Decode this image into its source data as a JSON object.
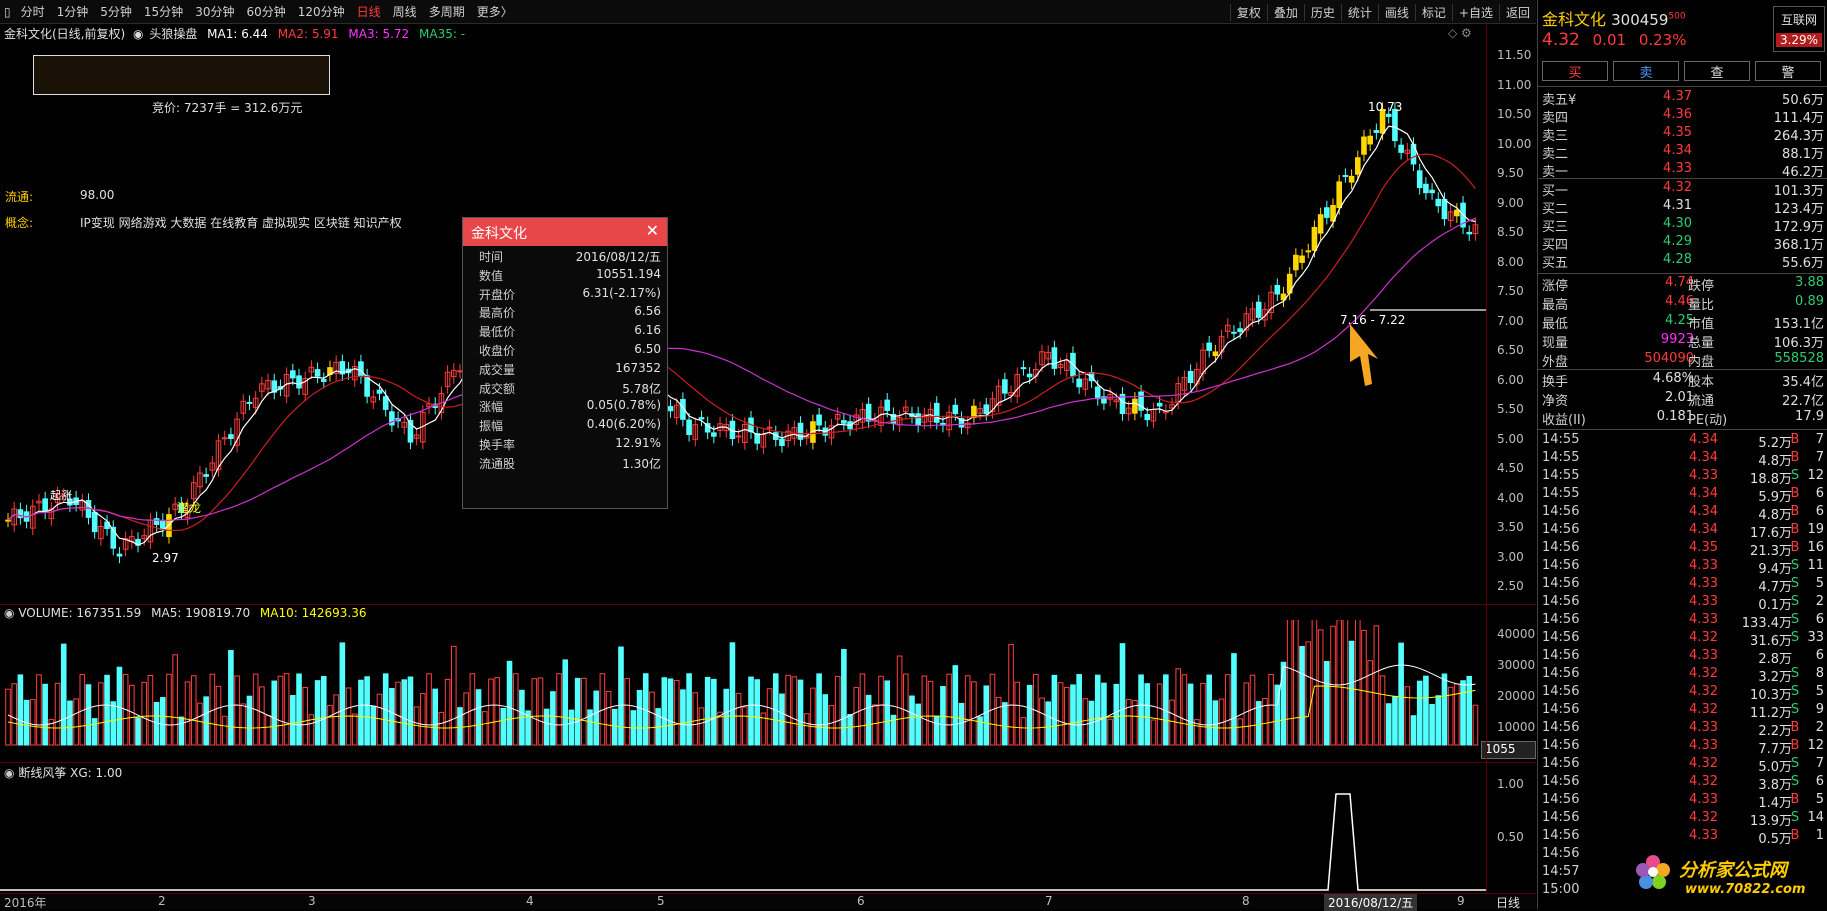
{
  "toolbar": {
    "tabs": [
      "分时",
      "1分钟",
      "5分钟",
      "15分钟",
      "30分钟",
      "60分钟",
      "120分钟",
      "日线",
      "周线",
      "多周期",
      "更多〉"
    ],
    "active_tab": "日线",
    "right_buttons": [
      "复权",
      "叠加",
      "历史",
      "统计",
      "画线",
      "标记",
      "+自选",
      "返回"
    ]
  },
  "chart": {
    "title": "金科文化(日线,前复权)",
    "indicator": "头狼操盘",
    "ma1": "MA1: 6.44",
    "ma2": "MA2: 5.91",
    "ma3": "MA3: 5.72",
    "ma35": "MA35: -",
    "auction": "竞价: 7237手 = 312.6万元",
    "liutong_label": "流通:",
    "liutong_value": "98.00",
    "concept_label": "概念:",
    "concept_value": "IP变现 网络游戏 大数据 在线教育 虚拟现实 区块链 知识产权",
    "high_label": "10.73",
    "low_label": "2.97",
    "range_label": "7.16 - 7.22",
    "qian_long": "潜龙",
    "qi_zhang": "起涨",
    "y_ticks": [
      "11.50",
      "11.00",
      "10.50",
      "10.00",
      "9.50",
      "9.00",
      "8.50",
      "8.00",
      "7.50",
      "7.00",
      "6.50",
      "6.00",
      "5.50",
      "5.00",
      "4.50",
      "4.00",
      "3.50",
      "3.00",
      "2.50"
    ]
  },
  "volume": {
    "label": "VOLUME: 167351.59",
    "ma5": "MA5: 190819.70",
    "ma10": "MA10: 142693.36",
    "y_ticks": [
      "40000",
      "30000",
      "20000",
      "10000"
    ],
    "current": "1055"
  },
  "indicator2": {
    "label": "断线风筝 XG: 1.00",
    "y_ticks": [
      "1.00",
      "0.50"
    ]
  },
  "x_axis": {
    "labels": [
      "2016年",
      "2",
      "3",
      "4",
      "5",
      "6",
      "7",
      "8",
      "9"
    ],
    "current_date": "2016/08/12/五",
    "period": "日线"
  },
  "popup": {
    "title": "金科文化",
    "rows": [
      {
        "k": "时间",
        "v": "2016/08/12/五",
        "c": "white"
      },
      {
        "k": "数值",
        "v": "10551.194",
        "c": "white"
      },
      {
        "k": "开盘价",
        "v": "6.31(-2.17%)",
        "c": "green"
      },
      {
        "k": "最高价",
        "v": "6.56",
        "c": "red"
      },
      {
        "k": "最低价",
        "v": "6.16",
        "c": "green"
      },
      {
        "k": "收盘价",
        "v": "6.50",
        "c": "red"
      },
      {
        "k": "成交量",
        "v": "167352",
        "c": "white"
      },
      {
        "k": "成交额",
        "v": "5.78亿",
        "c": "white"
      },
      {
        "k": "涨幅",
        "v": "0.05(0.78%)",
        "c": "red"
      },
      {
        "k": "振幅",
        "v": "0.40(6.20%)",
        "c": "white"
      },
      {
        "k": "换手率",
        "v": "12.91%",
        "c": "white"
      },
      {
        "k": "流通股",
        "v": "1.30亿",
        "c": "white"
      }
    ]
  },
  "stock": {
    "name": "金科文化",
    "code": "300459",
    "code_sup": "500",
    "price": "4.32",
    "change": "0.01",
    "change_pct": "0.23%",
    "tag": "互联网",
    "tag_pct": "3.29%",
    "buttons": [
      "买",
      "卖",
      "查",
      "警"
    ]
  },
  "orderbook": {
    "sell": [
      {
        "l": "卖五¥",
        "p": "4.37",
        "v": "50.6万",
        "c": "red"
      },
      {
        "l": "卖四",
        "p": "4.36",
        "v": "111.4万",
        "c": "red"
      },
      {
        "l": "卖三",
        "p": "4.35",
        "v": "264.3万",
        "c": "red"
      },
      {
        "l": "卖二",
        "p": "4.34",
        "v": "88.1万",
        "c": "red"
      },
      {
        "l": "卖一",
        "p": "4.33",
        "v": "46.2万",
        "c": "red"
      }
    ],
    "buy": [
      {
        "l": "买一",
        "p": "4.32",
        "v": "101.3万",
        "c": "red"
      },
      {
        "l": "买二",
        "p": "4.31",
        "v": "123.4万",
        "c": "white"
      },
      {
        "l": "买三",
        "p": "4.30",
        "v": "172.9万",
        "c": "green"
      },
      {
        "l": "买四",
        "p": "4.29",
        "v": "368.1万",
        "c": "green"
      },
      {
        "l": "买五",
        "p": "4.28",
        "v": "55.6万",
        "c": "green"
      }
    ]
  },
  "quote": [
    {
      "l": "涨停",
      "v": "4.74",
      "vc": "red",
      "l2": "跌停",
      "v2": "3.88",
      "v2c": "green"
    },
    {
      "l": "最高",
      "v": "4.46",
      "vc": "red",
      "l2": "量比",
      "v2": "0.89",
      "v2c": "green"
    },
    {
      "l": "最低",
      "v": "4.25",
      "vc": "green",
      "l2": "市值",
      "v2": "153.1亿",
      "v2c": "white"
    },
    {
      "l": "现量",
      "v": "9923",
      "vc": "magenta",
      "l2": "总量",
      "v2": "106.3万",
      "v2c": "white"
    },
    {
      "l": "外盘",
      "v": "504090",
      "vc": "red",
      "l2": "内盘",
      "v2": "558528",
      "v2c": "green"
    }
  ],
  "fundamentals": [
    {
      "l": "换手",
      "v": "4.68%",
      "l2": "股本",
      "v2": "35.4亿"
    },
    {
      "l": "净资",
      "v": "2.01",
      "l2": "流通",
      "v2": "22.7亿"
    },
    {
      "l": "收益(II)",
      "v": "0.181",
      "l2": "PE(动)",
      "v2": "17.9"
    }
  ],
  "ticks": [
    {
      "t": "14:55",
      "p": "4.34",
      "q": "5.2万",
      "s": "B",
      "n": "7",
      "pc": "red",
      "qc": "white"
    },
    {
      "t": "14:55",
      "p": "4.34",
      "q": "4.8万",
      "s": "B",
      "n": "7",
      "pc": "red",
      "qc": "white"
    },
    {
      "t": "14:55",
      "p": "4.33",
      "q": "18.8万",
      "s": "S",
      "n": "12",
      "pc": "red",
      "qc": "white"
    },
    {
      "t": "14:55",
      "p": "4.34",
      "q": "5.9万",
      "s": "B",
      "n": "6",
      "pc": "red",
      "qc": "white"
    },
    {
      "t": "14:56",
      "p": "4.34",
      "q": "4.8万",
      "s": "B",
      "n": "6",
      "pc": "red",
      "qc": "white"
    },
    {
      "t": "14:56",
      "p": "4.34",
      "q": "17.6万",
      "s": "B",
      "n": "19",
      "pc": "red",
      "qc": "white"
    },
    {
      "t": "14:56",
      "p": "4.35",
      "q": "21.3万",
      "s": "B",
      "n": "16",
      "pc": "red",
      "qc": "white"
    },
    {
      "t": "14:56",
      "p": "4.33",
      "q": "9.4万",
      "s": "S",
      "n": "11",
      "pc": "red",
      "qc": "white"
    },
    {
      "t": "14:56",
      "p": "4.33",
      "q": "4.7万",
      "s": "S",
      "n": "5",
      "pc": "red",
      "qc": "white"
    },
    {
      "t": "14:56",
      "p": "4.33",
      "q": "0.1万",
      "s": "S",
      "n": "2",
      "pc": "red",
      "qc": "white"
    },
    {
      "t": "14:56",
      "p": "4.33",
      "q": "133.4万",
      "s": "S",
      "n": "6",
      "pc": "red",
      "qc": "magenta"
    },
    {
      "t": "14:56",
      "p": "4.32",
      "q": "31.6万",
      "s": "S",
      "n": "33",
      "pc": "red",
      "qc": "magenta"
    },
    {
      "t": "14:56",
      "p": "4.33",
      "q": "2.8万",
      "s": "",
      "n": "6",
      "pc": "red",
      "qc": "white"
    },
    {
      "t": "14:56",
      "p": "4.32",
      "q": "3.2万",
      "s": "S",
      "n": "8",
      "pc": "red",
      "qc": "white"
    },
    {
      "t": "14:56",
      "p": "4.32",
      "q": "10.3万",
      "s": "S",
      "n": "5",
      "pc": "red",
      "qc": "white"
    },
    {
      "t": "14:56",
      "p": "4.32",
      "q": "11.2万",
      "s": "S",
      "n": "9",
      "pc": "red",
      "qc": "white"
    },
    {
      "t": "14:56",
      "p": "4.33",
      "q": "2.2万",
      "s": "B",
      "n": "2",
      "pc": "red",
      "qc": "white"
    },
    {
      "t": "14:56",
      "p": "4.33",
      "q": "7.7万",
      "s": "B",
      "n": "12",
      "pc": "red",
      "qc": "white"
    },
    {
      "t": "14:56",
      "p": "4.32",
      "q": "5.0万",
      "s": "S",
      "n": "7",
      "pc": "red",
      "qc": "white"
    },
    {
      "t": "14:56",
      "p": "4.32",
      "q": "3.8万",
      "s": "S",
      "n": "6",
      "pc": "red",
      "qc": "white"
    },
    {
      "t": "14:56",
      "p": "4.33",
      "q": "1.4万",
      "s": "B",
      "n": "5",
      "pc": "red",
      "qc": "white"
    },
    {
      "t": "14:56",
      "p": "4.32",
      "q": "13.9万",
      "s": "S",
      "n": "14",
      "pc": "red",
      "qc": "white"
    },
    {
      "t": "14:56",
      "p": "4.33",
      "q": "0.5万",
      "s": "B",
      "n": "1",
      "pc": "red",
      "qc": "white"
    },
    {
      "t": "14:56",
      "p": "",
      "q": "",
      "s": "",
      "n": "",
      "pc": "red",
      "qc": "white"
    },
    {
      "t": "14:57",
      "p": "",
      "q": "",
      "s": "",
      "n": "",
      "pc": "red",
      "qc": "white"
    },
    {
      "t": "15:00",
      "p": "",
      "q": "",
      "s": "",
      "n": "",
      "pc": "red",
      "qc": "white"
    }
  ],
  "watermark": {
    "text": "分析家公式网",
    "url": "www.70822.com"
  }
}
